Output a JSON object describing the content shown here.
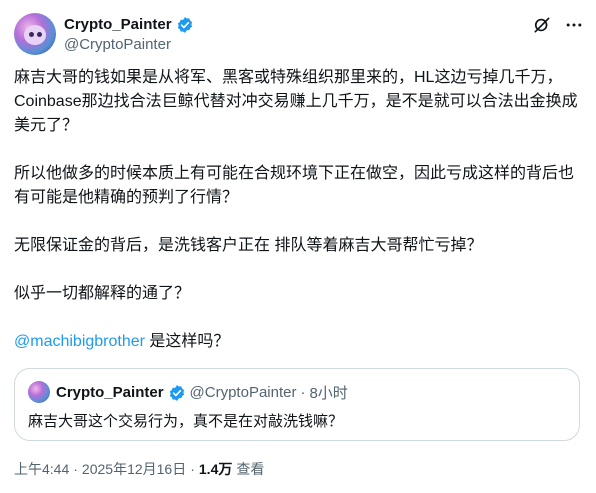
{
  "author": {
    "display_name": "Crypto_Painter",
    "handle": "@CryptoPainter"
  },
  "header": {
    "icons": [
      "grok-icon",
      "more-icon"
    ]
  },
  "tweet": {
    "paragraphs": [
      "麻吉大哥的钱如果是从将军、黑客或特殊组织那里来的，HL这边亏掉几千万，Coinbase那边找合法巨鲸代替对冲交易赚上几千万，是不是就可以合法出金换成美元了？",
      "所以他做多的时候本质上有可能在合规环境下正在做空，因此亏成这样的背后也有可能是他精确的预判了行情？",
      "无限保证金的背后，是洗钱客户正在 排队等着麻吉大哥帮忙亏掉？",
      "似乎一切都解释的通了？"
    ],
    "mention": "@machibigbrother",
    "mention_suffix": " 是这样吗？"
  },
  "quote": {
    "display_name": "Crypto_Painter",
    "handle": "@CryptoPainter",
    "dot": "·",
    "time": "8小时",
    "text": "麻吉大哥这个交易行为，真不是在对敲洗钱嘛？"
  },
  "meta": {
    "time": "上午4:44",
    "sep1": "·",
    "date": "2025年12月16日",
    "sep2": "·",
    "views_count": "1.4万",
    "views_label": "查看"
  },
  "colors": {
    "accent": "#1d9bf0",
    "muted": "#536471",
    "text": "#0f1419",
    "border": "#cfd9de"
  }
}
